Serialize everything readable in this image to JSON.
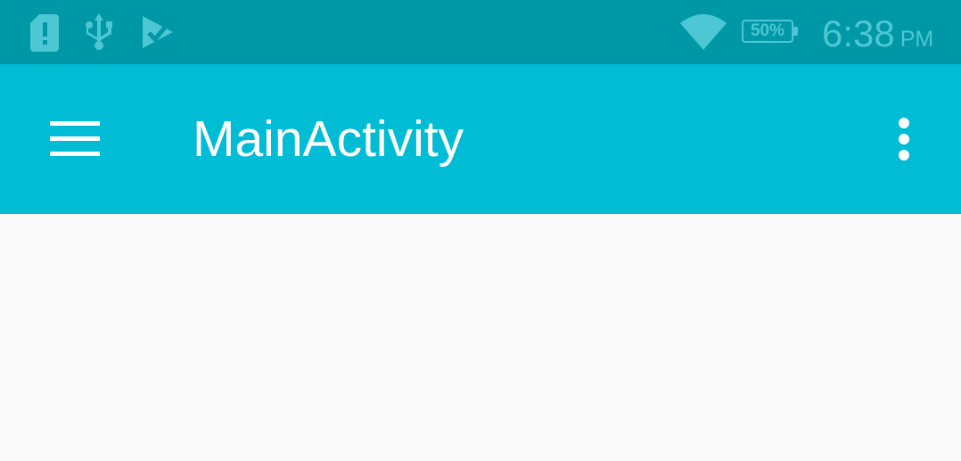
{
  "status_bar": {
    "notification_icons": [
      "sim-alert-icon",
      "usb-icon",
      "play-store-icon"
    ],
    "wifi_icon": "wifi-icon",
    "battery_icon": "battery-icon",
    "battery_percent": "50%",
    "battery_level": 0.5,
    "time": "6:38",
    "ampm": "PM"
  },
  "toolbar": {
    "menu_icon": "hamburger-menu-icon",
    "title": "MainActivity",
    "overflow_icon": "more-vert-icon"
  },
  "colors": {
    "status_bar": "#0097a7",
    "toolbar": "#00bcd4",
    "status_icons": "#4dc7d3",
    "toolbar_foreground": "#ffffff",
    "content_background": "#fafafa"
  }
}
